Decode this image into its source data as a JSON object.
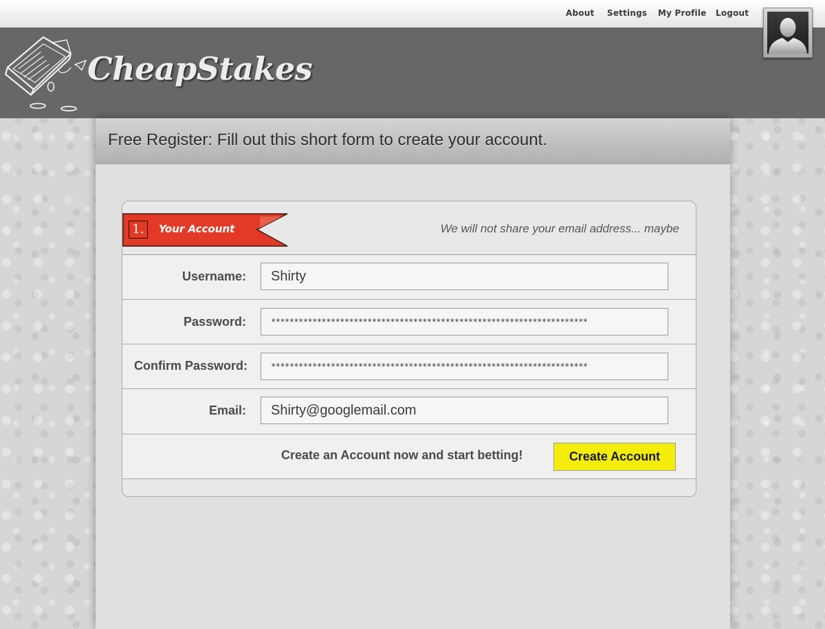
{
  "topnav": {
    "about": "About",
    "settings": "Settings",
    "my_profile": "My Profile",
    "logout": "Logout"
  },
  "brand": {
    "name": "CheapStakes"
  },
  "page": {
    "title": "Free Register: Fill out this short form to create your account."
  },
  "form": {
    "section_number": "1.",
    "section_title": "Your Account",
    "privacy_note": "We will not share your email address... maybe",
    "fields": {
      "username": {
        "label": "Username:",
        "value": "Shirty"
      },
      "password": {
        "label": "Password:",
        "value": "*********************************************************************"
      },
      "confirm_password": {
        "label": "Confirm Password:",
        "value": "*********************************************************************"
      },
      "email": {
        "label": "Email:",
        "value": "Shirty@googlemail.com"
      }
    },
    "submit_note": "Create an Account now and start betting!",
    "submit_label": "Create Account"
  },
  "colors": {
    "ribbon": "#e23a26",
    "button": "#f4ed0c",
    "header": "#676767"
  },
  "icons": {
    "avatar": "user-silhouette-icon",
    "logo": "betting-slip-icon"
  }
}
